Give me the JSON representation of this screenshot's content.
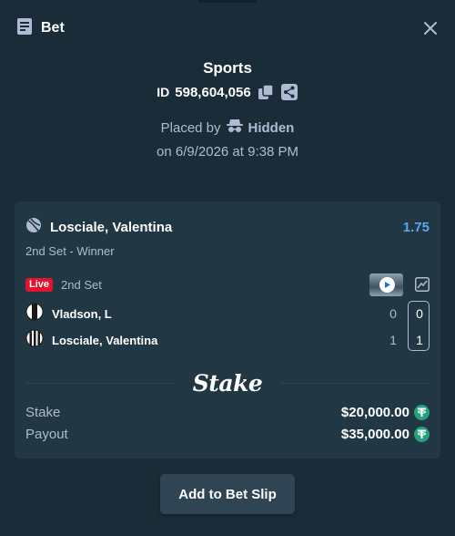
{
  "header": {
    "title": "Bet",
    "icon": "receipt-icon",
    "close_icon": "close-icon"
  },
  "summary": {
    "category": "Sports",
    "id_prefix": "ID",
    "bet_id": "598,604,056",
    "placed_by_label": "Placed by",
    "placer": "Hidden",
    "date_text": "on 6/9/2026 at 9:38 PM"
  },
  "bet": {
    "selection": "Losciale, Valentina",
    "odds": "1.75",
    "market": "2nd Set - Winner",
    "live_label": "Live",
    "period": "2nd Set",
    "teams": [
      {
        "name": "Vladson, L",
        "games": "0",
        "sets": "0"
      },
      {
        "name": "Losciale, Valentina",
        "games": "1",
        "sets": "1"
      }
    ],
    "brand": "Stake",
    "stake_label": "Stake",
    "stake_value": "$20,000.00",
    "payout_label": "Payout",
    "payout_value": "$35,000.00",
    "currency_icon": "tether-icon"
  },
  "actions": {
    "add_to_slip": "Add to Bet Slip"
  },
  "colors": {
    "background": "#1a2c38",
    "card": "#213743",
    "odds": "#5ba7ea",
    "live": "#e0142f",
    "tether": "#26a17b",
    "muted_text": "#b1bad3"
  }
}
